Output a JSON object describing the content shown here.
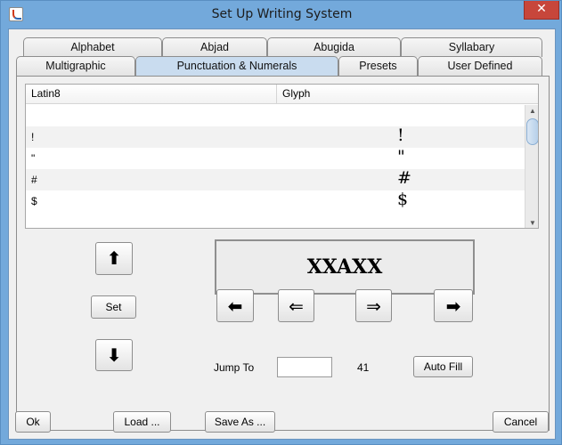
{
  "window": {
    "title": "Set Up Writing System",
    "close_glyph": "✕"
  },
  "tabs": {
    "row_back": [
      "Alphabet",
      "Abjad",
      "Abugida",
      "Syllabary"
    ],
    "row_front": [
      "Multigraphic",
      "Punctuation & Numerals",
      "Presets",
      "User Defined"
    ],
    "selected": "Punctuation & Numerals"
  },
  "table": {
    "columns": [
      "Latin8",
      "Glyph"
    ],
    "rows": [
      {
        "latin8": "",
        "glyph": ""
      },
      {
        "latin8": "!",
        "glyph": "!"
      },
      {
        "latin8": "\"",
        "glyph": "\""
      },
      {
        "latin8": "#",
        "glyph": "#"
      },
      {
        "latin8": "$",
        "glyph": "$"
      }
    ]
  },
  "preview": {
    "text": "XXAXX"
  },
  "vertical_controls": {
    "up_glyph": "⬆",
    "set_label": "Set",
    "down_glyph": "⬇"
  },
  "arrow_buttons": {
    "far_left": "⬅",
    "left": "⇐",
    "right": "⇒",
    "far_right": "➡"
  },
  "jump": {
    "label": "Jump To",
    "value": "",
    "count": "41",
    "autofill_label": "Auto Fill"
  },
  "footer": {
    "ok_label": "Ok",
    "load_label": "Load ...",
    "saveas_label": "Save As ...",
    "cancel_label": "Cancel"
  }
}
